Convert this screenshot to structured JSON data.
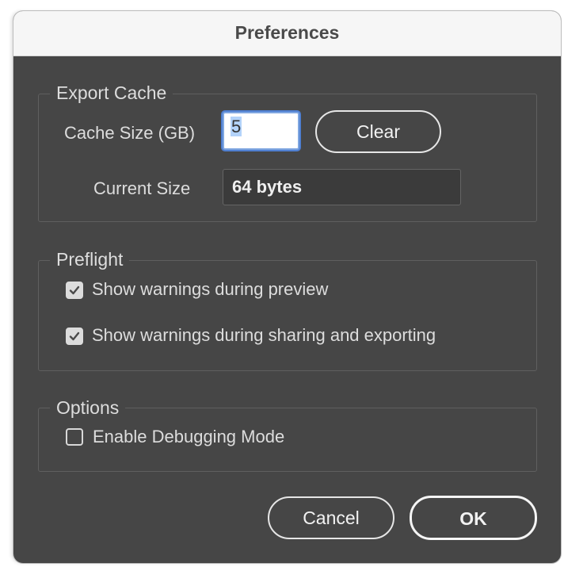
{
  "window": {
    "title": "Preferences"
  },
  "export_cache": {
    "legend": "Export Cache",
    "cache_size_label": "Cache Size (GB)",
    "cache_size_value": "5",
    "clear_label": "Clear",
    "current_size_label": "Current Size",
    "current_size_value": "64 bytes"
  },
  "preflight": {
    "legend": "Preflight",
    "options": [
      {
        "label": "Show warnings during preview",
        "checked": true
      },
      {
        "label": "Show warnings during sharing and exporting",
        "checked": true
      }
    ]
  },
  "options": {
    "legend": "Options",
    "debug_label": "Enable Debugging Mode",
    "debug_checked": false
  },
  "footer": {
    "cancel_label": "Cancel",
    "ok_label": "OK"
  },
  "colors": {
    "window_bg": "#464646",
    "titlebar_bg": "#f6f6f6",
    "focus_ring": "#4f7fd1",
    "selection": "#b3d3fa"
  }
}
